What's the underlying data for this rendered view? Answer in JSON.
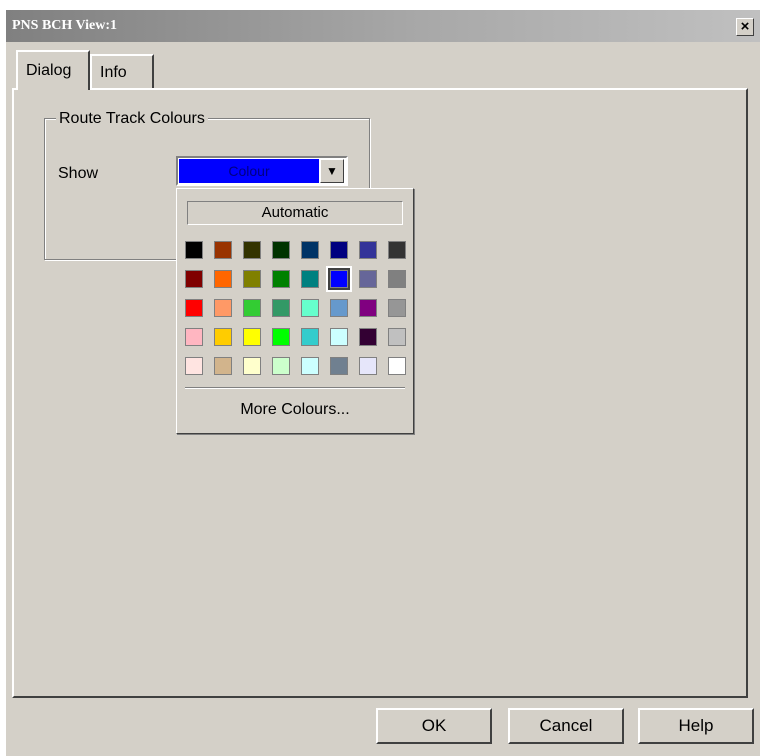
{
  "window": {
    "title": "PNS BCH View:1",
    "close_label": "×"
  },
  "tabs": [
    {
      "label": "Dialog"
    },
    {
      "label": "Info"
    }
  ],
  "group": {
    "title": "Route Track Colours",
    "show_label": "Show"
  },
  "combo": {
    "value": "Colour",
    "arrow": "▼",
    "value_color": "#0000ff"
  },
  "popup": {
    "automatic_label": "Automatic",
    "more_label": "More Colours...",
    "selected_index": 13,
    "swatches": [
      "#000000",
      "#993300",
      "#333300",
      "#003300",
      "#003366",
      "#000080",
      "#333399",
      "#333333",
      "#800000",
      "#ff6600",
      "#808000",
      "#008000",
      "#008080",
      "#0000ff",
      "#666699",
      "#808080",
      "#ff0000",
      "#ff9966",
      "#33cc33",
      "#339966",
      "#66ffcc",
      "#6699cc",
      "#800080",
      "#969696",
      "#ffb6c1",
      "#ffcc00",
      "#ffff00",
      "#00ff00",
      "#33cccc",
      "#ccffff",
      "#330033",
      "#c0c0c0",
      "#ffe4e1",
      "#d2b48c",
      "#ffffcc",
      "#ccffcc",
      "#ccffff",
      "#708090",
      "#e6e6fa",
      "#ffffff"
    ]
  },
  "buttons": {
    "ok": "OK",
    "cancel": "Cancel",
    "help": "Help"
  }
}
